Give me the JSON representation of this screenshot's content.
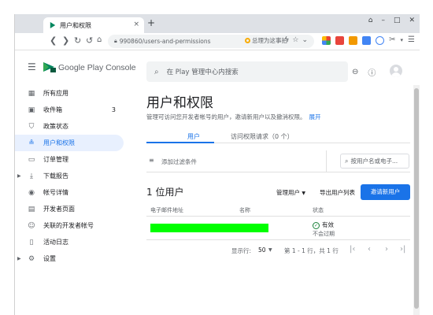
{
  "browser": {
    "tab_title": "用户和权限",
    "tab_close": "×",
    "new_tab": "+",
    "url": "990860/users-and-permissions",
    "bookmark_label": "总理为这事拍",
    "window_controls": [
      "⌂",
      "–",
      "□",
      "✕"
    ]
  },
  "header": {
    "brand": "Google Play Console",
    "search_placeholder": "在 Play 管理中心内搜索"
  },
  "sidebar": {
    "items": [
      {
        "label": "所有应用",
        "icon": "grid-icon",
        "glyph": "▦",
        "count": "",
        "expandable": false,
        "active": false
      },
      {
        "label": "收件箱",
        "icon": "inbox-icon",
        "glyph": "▣",
        "count": "3",
        "expandable": false,
        "active": false
      },
      {
        "label": "政策状态",
        "icon": "shield-icon",
        "glyph": "⛉",
        "count": "",
        "expandable": false,
        "active": false
      },
      {
        "label": "用户和权限",
        "icon": "users-icon",
        "glyph": "≗",
        "count": "",
        "expandable": false,
        "active": true
      },
      {
        "label": "订单管理",
        "icon": "card-icon",
        "glyph": "▭",
        "count": "",
        "expandable": false,
        "active": false
      },
      {
        "label": "下载报告",
        "icon": "download-icon",
        "glyph": "⤓",
        "count": "",
        "expandable": true,
        "active": false
      },
      {
        "label": "帐号详情",
        "icon": "account-icon",
        "glyph": "◉",
        "count": "",
        "expandable": false,
        "active": false
      },
      {
        "label": "开发者页面",
        "icon": "page-icon",
        "glyph": "▤",
        "count": "",
        "expandable": false,
        "active": false
      },
      {
        "label": "关联的开发者帐号",
        "icon": "link-account-icon",
        "glyph": "☺",
        "count": "",
        "expandable": false,
        "active": false
      },
      {
        "label": "活动日志",
        "icon": "log-icon",
        "glyph": "▯",
        "count": "",
        "expandable": false,
        "active": false
      },
      {
        "label": "设置",
        "icon": "gear-icon",
        "glyph": "⚙",
        "count": "",
        "expandable": true,
        "active": false
      }
    ]
  },
  "main": {
    "title": "用户和权限",
    "description": "管理可访问您开发者帐号的用户，邀请新用户以及撤消权限。",
    "expand_link": "展开",
    "tabs": [
      "用户",
      "访问权限请求（0 个）"
    ],
    "filter_label": "添加过滤条件",
    "user_search_placeholder": "按用户名或电子...",
    "users_count": "1 位用户",
    "manage_users": "管理用户",
    "export_list": "导出用户列表",
    "add_user": "邀请新用户",
    "columns": [
      "电子邮件地址",
      "名称",
      "状态"
    ],
    "row": {
      "status": "有效",
      "expiry": "不会过期"
    },
    "pagination": {
      "rows_label": "显示行:",
      "rows_value": "50",
      "range": "第 1 - 1 行，共 1 行"
    }
  },
  "colors": {
    "accent": "#1a73e8",
    "redaction": "#00ff00",
    "success": "#188038"
  }
}
